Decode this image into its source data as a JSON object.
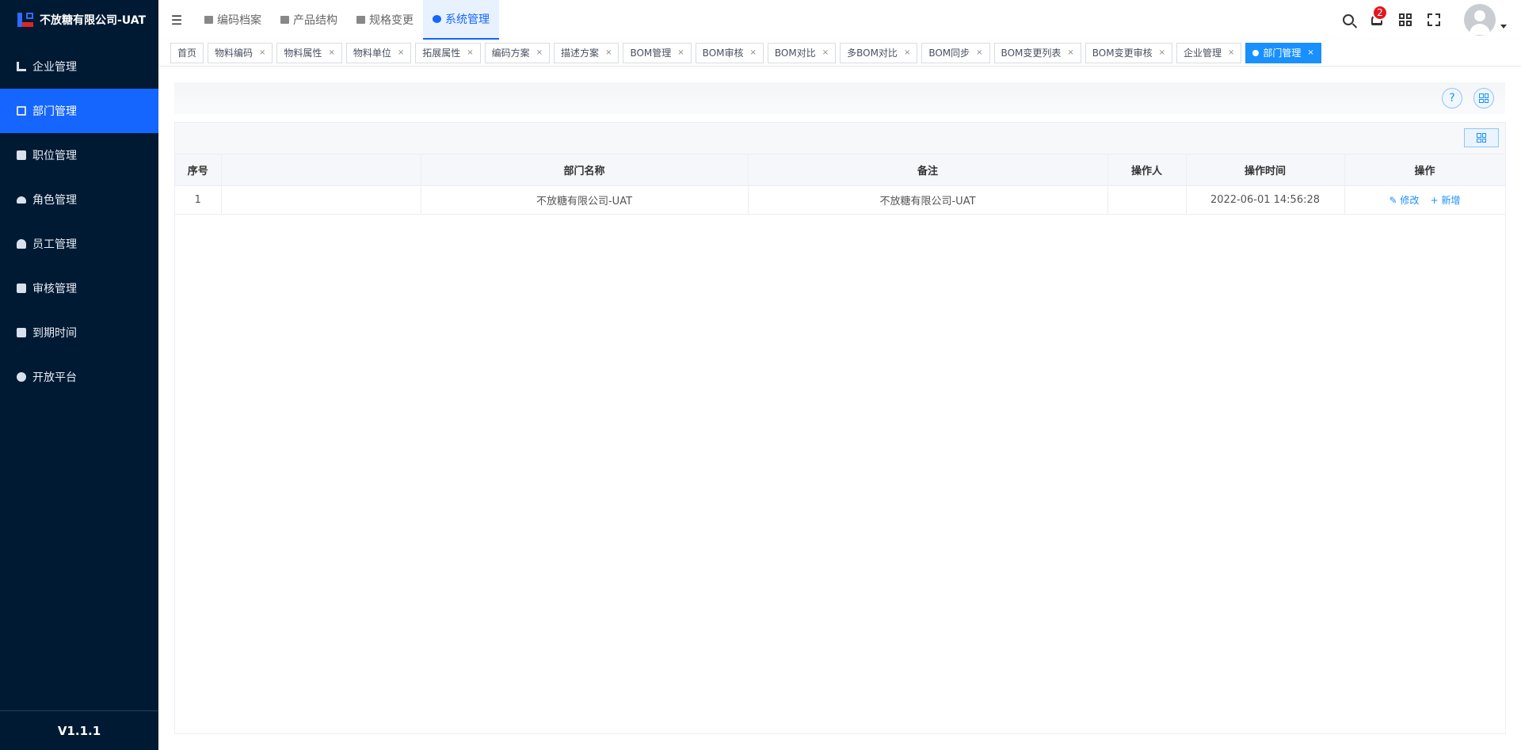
{
  "app": {
    "title": "不放糖有限公司-UAT",
    "version": "V1.1.1"
  },
  "sidebar": {
    "items": [
      {
        "label": "企业管理",
        "icon": "building-icon"
      },
      {
        "label": "部门管理",
        "icon": "tree-icon",
        "active": true
      },
      {
        "label": "职位管理",
        "icon": "badge-icon"
      },
      {
        "label": "角色管理",
        "icon": "car-icon"
      },
      {
        "label": "员工管理",
        "icon": "user-icon"
      },
      {
        "label": "审核管理",
        "icon": "checkbox-icon"
      },
      {
        "label": "到期时间",
        "icon": "calendar-icon"
      },
      {
        "label": "开放平台",
        "icon": "headset-icon"
      }
    ]
  },
  "topnav": {
    "items": [
      {
        "label": "编码档案",
        "icon": "folder-icon"
      },
      {
        "label": "产品结构",
        "icon": "layers-icon"
      },
      {
        "label": "规格变更",
        "icon": "swap-icon"
      },
      {
        "label": "系统管理",
        "icon": "gear-icon",
        "active": true
      }
    ]
  },
  "notifications": {
    "count": "2"
  },
  "tags": [
    {
      "label": "首页",
      "closable": false
    },
    {
      "label": "物料编码",
      "closable": true
    },
    {
      "label": "物料属性",
      "closable": true
    },
    {
      "label": "物料单位",
      "closable": true
    },
    {
      "label": "拓展属性",
      "closable": true
    },
    {
      "label": "编码方案",
      "closable": true
    },
    {
      "label": "描述方案",
      "closable": true
    },
    {
      "label": "BOM管理",
      "closable": true
    },
    {
      "label": "BOM审核",
      "closable": true
    },
    {
      "label": "BOM对比",
      "closable": true
    },
    {
      "label": "多BOM对比",
      "closable": true
    },
    {
      "label": "BOM同步",
      "closable": true
    },
    {
      "label": "BOM变更列表",
      "closable": true
    },
    {
      "label": "BOM变更审核",
      "closable": true
    },
    {
      "label": "企业管理",
      "closable": true
    },
    {
      "label": "部门管理",
      "closable": true,
      "active": true
    }
  ],
  "tag_close": "×",
  "search_panel": {
    "help_label": "?"
  },
  "table": {
    "headers": [
      "序号",
      "",
      "部门名称",
      "备注",
      "操作人",
      "操作时间",
      "操作"
    ],
    "rows": [
      {
        "index": "1",
        "blank": "",
        "name": "不放糖有限公司-UAT",
        "remark": "不放糖有限公司-UAT",
        "operator": "",
        "time": "2022-06-01 14:56:28",
        "edit_label": "修改",
        "edit_icon": "✎",
        "add_label": "新增",
        "add_icon": "+"
      }
    ]
  },
  "colors": {
    "sidebar_bg": "#001a33",
    "accent": "#1565ff",
    "tag_active": "#1890ff",
    "badge": "#e5161d"
  }
}
